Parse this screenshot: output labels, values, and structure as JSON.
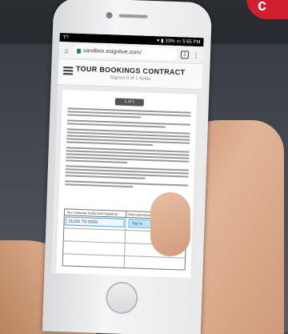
{
  "brand": {
    "accent": "#d0202f",
    "badge_fragment": "c"
  },
  "status_bar": {
    "left": "T?",
    "battery": "33%",
    "time": "5:55 PM"
  },
  "browser": {
    "url": "sandbox.esignlive.com/",
    "tab_count": "1",
    "icons": [
      "home-icon",
      "lock-icon",
      "tabs-icon",
      "menu-dots-icon"
    ]
  },
  "document": {
    "title": "TOUR BOOKINGS CONTRACT",
    "signed_status": "Signed 0 of 1 fields",
    "page_indicator": "1 of 1",
    "table": {
      "col1_header": "Tour Company Authorized Signature",
      "col2_header": "Client Authorized Signature",
      "sign_field_label": "CLICK TO SIGN",
      "signer_tag": "Tap to"
    }
  }
}
